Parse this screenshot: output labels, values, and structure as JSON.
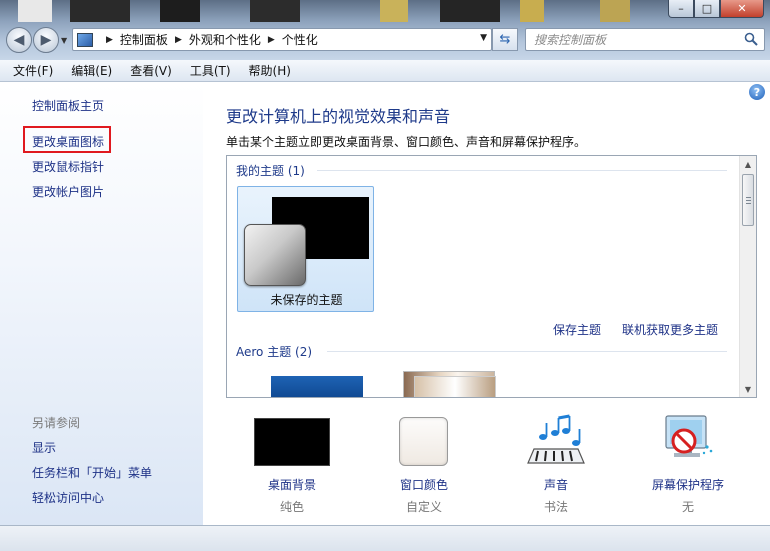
{
  "window": {
    "controls": [
      "–",
      "□",
      "✕"
    ]
  },
  "address": {
    "crumbs": [
      "控制面板",
      "外观和个性化",
      "个性化"
    ]
  },
  "search": {
    "placeholder": "搜索控制面板"
  },
  "menu": [
    "文件(F)",
    "编辑(E)",
    "查看(V)",
    "工具(T)",
    "帮助(H)"
  ],
  "sidebar": {
    "links": [
      "控制面板主页",
      "更改桌面图标",
      "更改鼠标指针",
      "更改帐户图片"
    ],
    "see_also_label": "另请参阅",
    "see_also": [
      "显示",
      "任务栏和「开始」菜单",
      "轻松访问中心"
    ]
  },
  "main": {
    "help": "?",
    "heading": "更改计算机上的视觉效果和声音",
    "subtitle": "单击某个主题立即更改桌面背景、窗口颜色、声音和屏幕保护程序。",
    "my_themes_label": "我的主题 (1)",
    "unsaved_theme": "未保存的主题",
    "save_theme": "保存主题",
    "more_themes": "联机获取更多主题",
    "aero_label": "Aero 主题 (2)"
  },
  "settings": [
    {
      "label": "桌面背景",
      "value": "纯色",
      "icon": "desktop-background-icon"
    },
    {
      "label": "窗口颜色",
      "value": "自定义",
      "icon": "window-color-icon"
    },
    {
      "label": "声音",
      "value": "书法",
      "icon": "sound-icon"
    },
    {
      "label": "屏幕保护程序",
      "value": "无",
      "icon": "screensaver-icon"
    }
  ],
  "colors": {
    "link": "#1e3287",
    "heading": "#1e3a8a",
    "highlight": "#e0191f"
  }
}
